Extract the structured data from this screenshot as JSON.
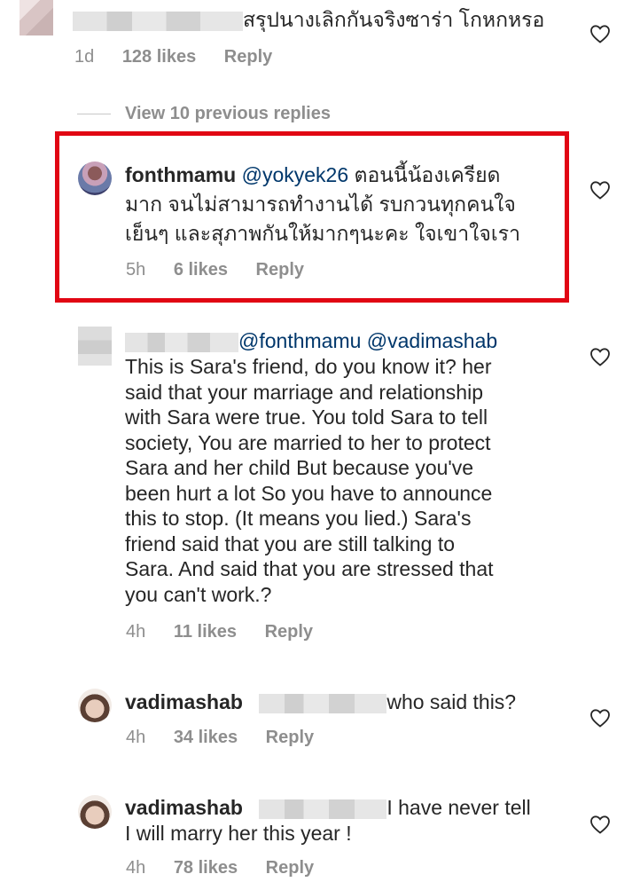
{
  "comment_top": {
    "text": "สรุปนางเลิกกันจริงซาร่า โกหกหรอ",
    "time": "1d",
    "likes": "128 likes",
    "reply": "Reply"
  },
  "view_replies": "View 10 previous replies",
  "reply1": {
    "username": "fonthmamu",
    "mention": "@yokyek26",
    "text_line1": " ตอนนี้น้องเครียด",
    "text_line2": "มาก จนไม่สามารถทำงานได้ รบกวนทุกคนใจ",
    "text_line3": "เย็นๆ และสุภาพกันให้มากๆนะคะ ใจเขาใจเรา",
    "time": "5h",
    "likes": "6 likes",
    "reply": "Reply"
  },
  "reply2": {
    "mentions": "@fonthmamu @vadimashab",
    "lines": [
      "This is Sara's friend, do you know it?  her",
      "said that your marriage and relationship",
      "with Sara were true. You told Sara to tell",
      "society,  You are married to her to protect",
      "Sara and her child  But because you've",
      "been hurt a lot  So you have to announce",
      "this to stop. (It means you lied.) Sara's",
      "friend said that you are still talking to",
      "Sara.  And said that you are stressed that",
      "you can't work.?"
    ],
    "time": "4h",
    "likes": "11 likes",
    "reply": "Reply"
  },
  "reply3": {
    "username": "vadimashab",
    "text": "who said this?",
    "time": "4h",
    "likes": "34 likes",
    "reply": "Reply"
  },
  "reply4": {
    "username": "vadimashab",
    "text_line1": "I have never tell",
    "text_line2": "I will marry her this year !",
    "time": "4h",
    "likes": "78 likes",
    "reply": "Reply"
  },
  "colors": {
    "highlight": "#e10613",
    "mention": "#00376b",
    "meta": "#8e8e8e"
  },
  "icons": [
    "heart-icon"
  ]
}
